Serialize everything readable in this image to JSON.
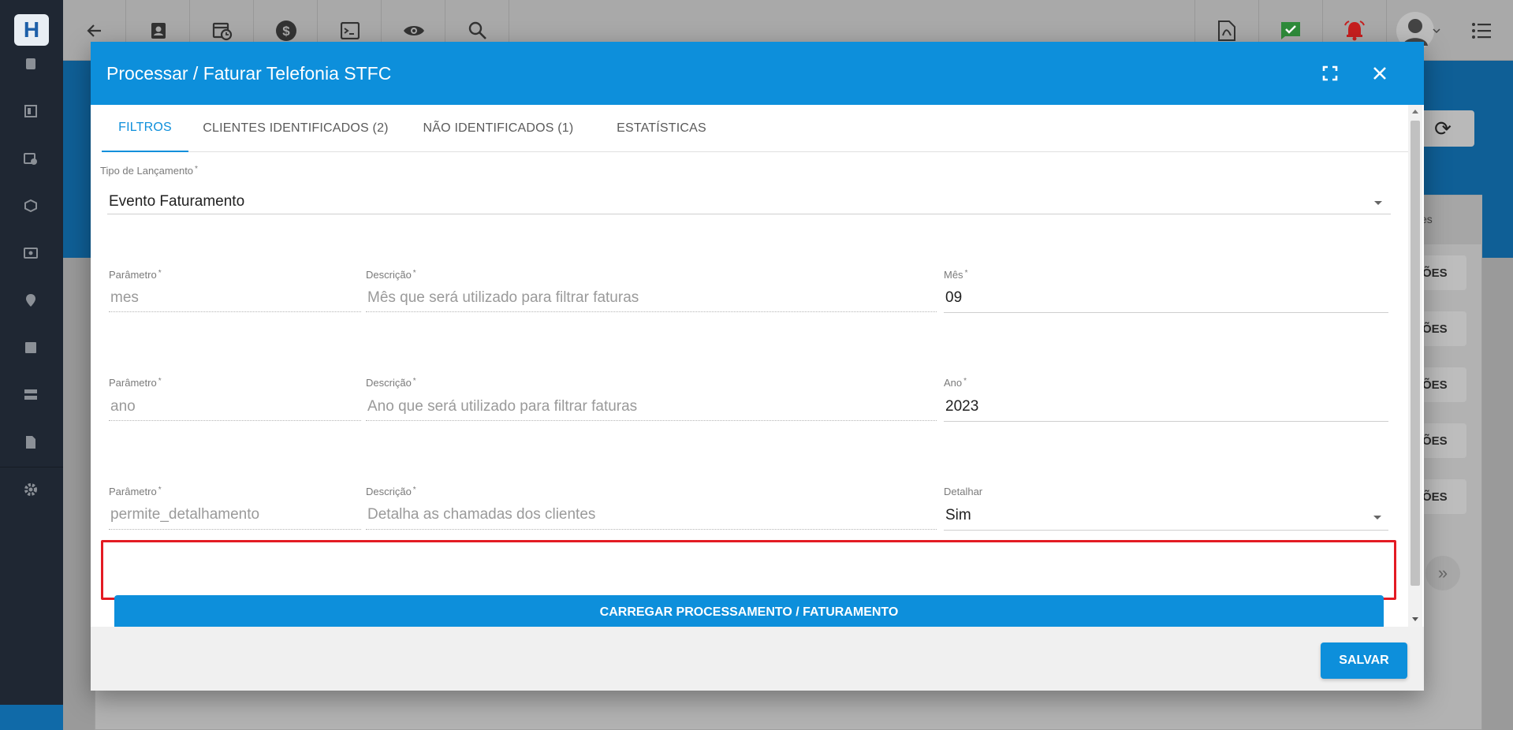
{
  "modal": {
    "title": "Processar / Faturar Telefonia STFC",
    "tabs": [
      {
        "label": "FILTROS"
      },
      {
        "label": "CLIENTES IDENTIFICADOS (2)"
      },
      {
        "label": "NÃO IDENTIFICADOS (1)"
      },
      {
        "label": "ESTATÍSTICAS"
      }
    ],
    "tipo_lancamento": {
      "label": "Tipo de Lançamento",
      "value": "Evento Faturamento"
    },
    "params": [
      {
        "param_label": "Parâmetro",
        "param_value": "mes",
        "desc_label": "Descrição",
        "desc_value": "Mês que será utilizado para filtrar faturas",
        "field_label": "Mês",
        "field_value": "09"
      },
      {
        "param_label": "Parâmetro",
        "param_value": "ano",
        "desc_label": "Descrição",
        "desc_value": "Ano que será utilizado para filtrar faturas",
        "field_label": "Ano",
        "field_value": "2023"
      },
      {
        "param_label": "Parâmetro",
        "param_value": "permite_detalhamento",
        "desc_label": "Descrição",
        "desc_value": "Detalha as chamadas dos clientes",
        "field_label": "Detalhar",
        "field_value": "Sim"
      }
    ],
    "required_mark": "*",
    "load_button": "CARREGAR PROCESSAMENTO / FATURAMENTO",
    "save_button": "SALVAR"
  },
  "background": {
    "header_fragment": "es",
    "action_fragment": "ÕES",
    "logo": "H"
  },
  "colors": {
    "primary": "#0d8fdb",
    "highlight": "#e31b23"
  },
  "icons": [
    "back-arrow-icon",
    "contact-icon",
    "calendar-clock-icon",
    "dollar-icon",
    "terminal-icon",
    "eye-icon",
    "search-icon",
    "pdf-icon",
    "check-icon",
    "alarm-icon",
    "avatar-icon",
    "list-icon",
    "fullscreen-icon",
    "close-icon"
  ]
}
